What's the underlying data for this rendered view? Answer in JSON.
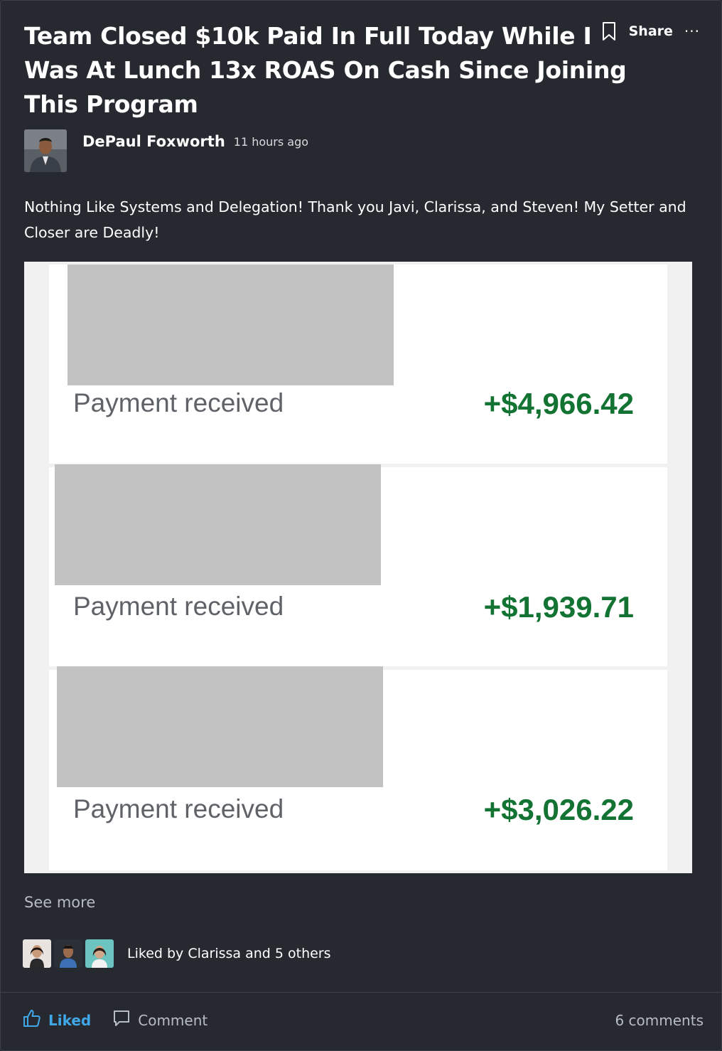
{
  "post": {
    "title": "Team Closed $10k Paid In Full Today While I Was At Lunch 13x ROAS On Cash Since Joining This Program",
    "share_label": "Share",
    "more_label": "···",
    "author": {
      "name": "DePaul Foxworth",
      "timestamp": "11 hours ago"
    },
    "body": "Nothing Like Systems and Delegation! Thank you Javi, Clarissa, and Steven! My Setter and Closer are Deadly!",
    "payments": [
      {
        "label": "Payment received",
        "amount": "+$4,966.42"
      },
      {
        "label": "Payment received",
        "amount": "+$1,939.71"
      },
      {
        "label": "Payment received",
        "amount": "+$3,026.22"
      }
    ],
    "see_more": "See more",
    "liked_by": "Liked by Clarissa and 5 others",
    "actions": {
      "like_label": "Liked",
      "comment_label": "Comment",
      "comment_count": "6 comments"
    }
  },
  "colors": {
    "background": "#26292f",
    "accent": "#41a8e8",
    "payment_amount": "#137333",
    "redaction": "#c2c2c2"
  },
  "icons": [
    "bookmark-icon",
    "more-icon",
    "thumbs-up-icon",
    "comment-icon"
  ]
}
